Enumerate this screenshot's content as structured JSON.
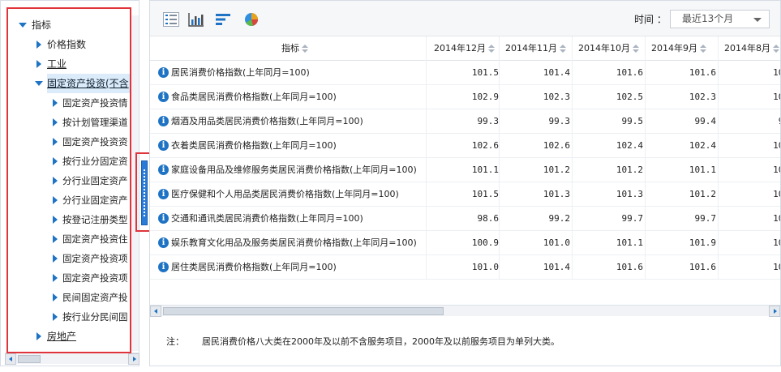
{
  "tree": {
    "items": [
      {
        "label": "指标",
        "level": 0,
        "expanded": true
      },
      {
        "label": "价格指数",
        "level": 1,
        "expanded": false
      },
      {
        "label": "工业",
        "level": 1,
        "expanded": false
      },
      {
        "label": "固定资产投资(不含",
        "level": 1,
        "expanded": true
      },
      {
        "label": "固定资产投资情",
        "level": 2
      },
      {
        "label": "按计划管理渠道",
        "level": 2
      },
      {
        "label": "固定资产投资资",
        "level": 2
      },
      {
        "label": "按行业分固定资",
        "level": 2
      },
      {
        "label": "分行业固定资产",
        "level": 2
      },
      {
        "label": "分行业固定资产",
        "level": 2
      },
      {
        "label": "按登记注册类型",
        "level": 2
      },
      {
        "label": "固定资产投资住",
        "level": 2
      },
      {
        "label": "固定资产投资项",
        "level": 2
      },
      {
        "label": "固定资产投资项",
        "level": 2
      },
      {
        "label": "民间固定资产投",
        "level": 2
      },
      {
        "label": "按行业分民间固",
        "level": 2
      },
      {
        "label": "房地产",
        "level": 1,
        "expanded": false
      }
    ]
  },
  "toolbar": {
    "icons": [
      "table-icon",
      "bar-chart-icon",
      "horizontal-bar-icon",
      "pie-chart-icon"
    ],
    "time_label": "时间 ：",
    "time_value": "最近13个月"
  },
  "table": {
    "header_name": "指标",
    "columns": [
      "2014年12月",
      "2014年11月",
      "2014年10月",
      "2014年9月",
      "2014年8月"
    ],
    "rows": [
      {
        "name": "居民消费价格指数(上年同月=100)",
        "values": [
          "101.5",
          "101.4",
          "101.6",
          "101.6",
          "102"
        ]
      },
      {
        "name": "食品类居民消费价格指数(上年同月=100)",
        "values": [
          "102.9",
          "102.3",
          "102.5",
          "102.3",
          "103"
        ]
      },
      {
        "name": "烟酒及用品类居民消费价格指数(上年同月=100)",
        "values": [
          "99.3",
          "99.3",
          "99.5",
          "99.4",
          "99"
        ]
      },
      {
        "name": "衣着类居民消费价格指数(上年同月=100)",
        "values": [
          "102.6",
          "102.6",
          "102.4",
          "102.4",
          "102"
        ]
      },
      {
        "name": "家庭设备用品及维修服务类居民消费价格指数(上年同月=100)",
        "values": [
          "101.1",
          "101.2",
          "101.2",
          "101.1",
          "101"
        ]
      },
      {
        "name": "医疗保健和个人用品类居民消费价格指数(上年同月=100)",
        "values": [
          "101.5",
          "101.3",
          "101.3",
          "101.2",
          "101"
        ]
      },
      {
        "name": "交通和通讯类居民消费价格指数(上年同月=100)",
        "values": [
          "98.6",
          "99.2",
          "99.7",
          "99.7",
          "100"
        ]
      },
      {
        "name": "娱乐教育文化用品及服务类居民消费价格指数(上年同月=100)",
        "values": [
          "100.9",
          "101.0",
          "101.1",
          "101.9",
          "101"
        ]
      },
      {
        "name": "居住类居民消费价格指数(上年同月=100)",
        "values": [
          "101.0",
          "101.4",
          "101.6",
          "101.6",
          "101"
        ]
      }
    ]
  },
  "note": {
    "label": "注：",
    "text": "居民消费价格八大类在2000年及以前不含服务项目，2000年及以前服务项目为单列大类。"
  },
  "colors": {
    "accent": "#1e73c4",
    "highlight_box": "#e0343c"
  }
}
